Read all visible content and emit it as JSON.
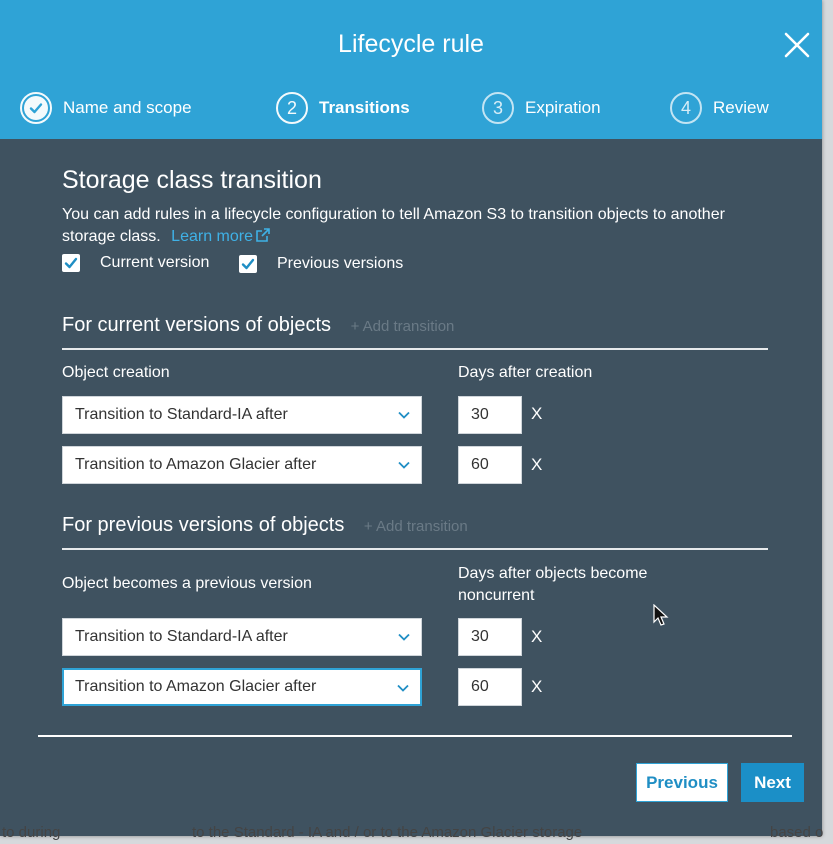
{
  "dialog": {
    "title": "Lifecycle rule",
    "close_icon": "close-icon"
  },
  "steps": [
    {
      "number": "1",
      "label": "Name and scope",
      "state": "done"
    },
    {
      "number": "2",
      "label": "Transitions",
      "state": "active"
    },
    {
      "number": "3",
      "label": "Expiration",
      "state": "pending"
    },
    {
      "number": "4",
      "label": "Review",
      "state": "pending"
    }
  ],
  "storage": {
    "heading": "Storage class transition",
    "description": "You can add rules in a lifecycle configuration to tell Amazon S3 to transition objects to another storage class.",
    "learn_more": "Learn more",
    "current_version_label": "Current version",
    "current_version_checked": true,
    "previous_versions_label": "Previous versions",
    "previous_versions_checked": true
  },
  "current_section": {
    "title": "For current versions of objects",
    "add_label": "+ Add transition",
    "col1_label": "Object creation",
    "col2_label": "Days after creation",
    "rows": [
      {
        "transition": "Transition to Standard-IA after",
        "days": "30",
        "remove": "X"
      },
      {
        "transition": "Transition to Amazon Glacier after",
        "days": "60",
        "remove": "X"
      }
    ]
  },
  "previous_section": {
    "title": "For previous versions of objects",
    "add_label": "+ Add transition",
    "col1_label": "Object becomes a previous version",
    "col2_label": "Days after objects become noncurrent",
    "rows": [
      {
        "transition": "Transition to Standard-IA after",
        "days": "30",
        "remove": "X"
      },
      {
        "transition": "Transition to Amazon Glacier after",
        "days": "60",
        "remove": "X"
      }
    ]
  },
  "footer": {
    "previous_label": "Previous",
    "next_label": "Next"
  },
  "background_text": {
    "left": "to during",
    "middle": "to the Standard - IA and / or to the Amazon Glacier storage",
    "right": "based o"
  },
  "colors": {
    "header": "#2fa3d6",
    "body": "#3f5260",
    "link": "#3fb1e6",
    "primary_button": "#1b8fc7"
  }
}
